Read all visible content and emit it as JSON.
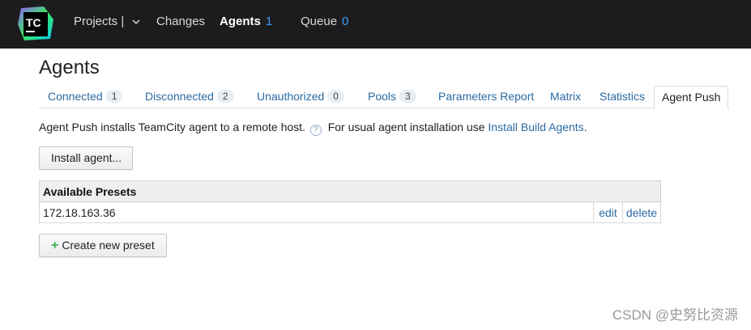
{
  "header": {
    "logo_text": "TC",
    "nav": [
      {
        "label": "Projects |",
        "count": ""
      },
      {
        "label": "Changes",
        "count": ""
      },
      {
        "label": "Agents",
        "count": "1"
      },
      {
        "label": "Queue",
        "count": "0"
      }
    ],
    "active": "Agents"
  },
  "page": {
    "title": "Agents"
  },
  "tabs": [
    {
      "label": "Connected",
      "count": "1"
    },
    {
      "label": "Disconnected",
      "count": "2"
    },
    {
      "label": "Unauthorized",
      "count": "0"
    },
    {
      "label": "Pools",
      "count": "3"
    },
    {
      "label": "Parameters Report",
      "count": ""
    },
    {
      "label": "Matrix",
      "count": ""
    },
    {
      "label": "Statistics",
      "count": ""
    },
    {
      "label": "Agent Push",
      "count": "",
      "active": true
    }
  ],
  "description": {
    "text": "Agent Push installs TeamCity agent to a remote host.",
    "help_icon": "?",
    "text2": "For usual agent installation use",
    "link": "Install Build Agents",
    "end": "."
  },
  "buttons": {
    "install": "Install agent...",
    "create_plus": "+",
    "create": "Create new preset"
  },
  "presets_table": {
    "header": "Available Presets",
    "rows": [
      {
        "name": "172.18.163.36",
        "edit": "edit",
        "delete": "delete"
      }
    ]
  },
  "watermark": "CSDN @史努比资源",
  "colors": {
    "header_bg": "#1c1c1e",
    "link": "#2c6aa0",
    "count_blue": "#3b9cff",
    "plus_green": "#3cae4f"
  }
}
